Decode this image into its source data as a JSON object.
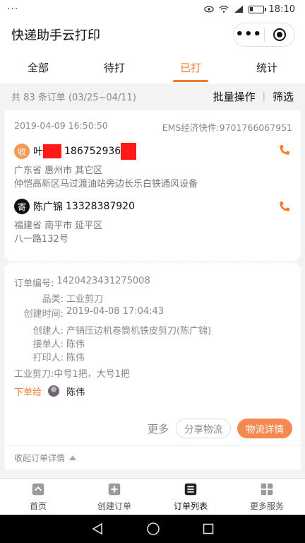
{
  "statusbar": {
    "left": "···",
    "time": "18:10"
  },
  "titlebar": {
    "title": "快递助手云打印"
  },
  "tabs": [
    {
      "label": "全部",
      "active": false
    },
    {
      "label": "待打",
      "active": false
    },
    {
      "label": "已打",
      "active": true
    },
    {
      "label": "统计",
      "active": false
    }
  ],
  "summary": {
    "count": "共 83 条订单 (03/25~04/11)",
    "batch": "批量操作",
    "filter": "筛选"
  },
  "order": {
    "datetime": "2019-04-09 16:50:50",
    "waybill": "EMS经济快件:9701766067951",
    "receiver": {
      "badge": "收",
      "name": "叶",
      "phone": "186752936",
      "addr1": "广东省 惠州市 其它区",
      "addr2": "仲恺高新区马过渡油站旁边长乐白铁通风设备"
    },
    "sender": {
      "badge": "寄",
      "name": "陈广锦",
      "phone": "13328387920",
      "addr1": "福建省 南平市 延平区",
      "addr2": "八一路132号"
    },
    "details": [
      {
        "key": "订单编号:",
        "value": "1420423431275008"
      },
      {
        "key": "品类:",
        "value": "工业剪刀"
      },
      {
        "key": "创建时间:",
        "value": "2019-04-08 17:04:43"
      },
      {
        "key": "创建人:",
        "value": "产销压边机卷筒机铁皮剪刀(陈广锦)"
      },
      {
        "key": "接单人:",
        "value": "陈伟"
      },
      {
        "key": "打印人:",
        "value": "陈伟"
      }
    ],
    "item_note": "工业剪刀:中号1把，大号1把",
    "dealer_label": "下单给",
    "dealer_name": "陈伟",
    "more": "更多",
    "share": "分享物流",
    "detail": "物流详情",
    "collapse": "收起订单详情"
  },
  "bottomnav": [
    {
      "label": "首页",
      "icon": "home-icon"
    },
    {
      "label": "创建订单",
      "icon": "plus-icon"
    },
    {
      "label": "订单列表",
      "icon": "list-icon"
    },
    {
      "label": "更多服务",
      "icon": "grid-icon"
    }
  ],
  "colors": {
    "accent": "#f37b2a",
    "detail_button": "#f48a52",
    "redaction": "#ff1a1a"
  }
}
